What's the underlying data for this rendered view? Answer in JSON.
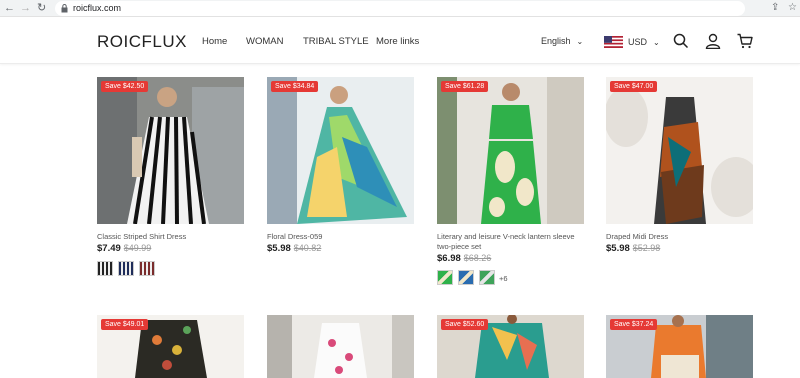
{
  "browser": {
    "url": "roicflux.com",
    "back_icon": "arrow-left-icon",
    "forward_icon": "arrow-right-icon",
    "reload_icon": "reload-icon"
  },
  "header": {
    "logo": "ROICFLUX",
    "menu": [
      "Home",
      "WOMAN",
      "TRIBAL STYLE",
      "More links"
    ],
    "language": "English",
    "currency": "USD",
    "icons": [
      "search-icon",
      "user-icon",
      "cart-icon"
    ]
  },
  "products": [
    {
      "save": "Save $42.50",
      "name": "Classic Striped Shirt Dress",
      "price": "$7.49",
      "original": "$49.99",
      "swatches": 3,
      "more": ""
    },
    {
      "save": "Save $34.84",
      "name": "Floral Dress-059",
      "price": "$5.98",
      "original": "$40.82",
      "swatches": 0,
      "more": ""
    },
    {
      "save": "Save $61.28",
      "name": "Literary and leisure V-neck lantern sleeve two-piece set",
      "price": "$6.98",
      "original": "$68.26",
      "swatches": 3,
      "more": "+6"
    },
    {
      "save": "Save $47.00",
      "name": "Draped Midi Dress",
      "price": "$5.98",
      "original": "$52.98",
      "swatches": 0,
      "more": ""
    },
    {
      "save": "Save $49.01"
    },
    {
      "save": ""
    },
    {
      "save": "Save $52.60"
    },
    {
      "save": "Save $37.24"
    }
  ],
  "colors": {
    "save_badge": "#e53935",
    "accent_green": "#2fb14a"
  }
}
